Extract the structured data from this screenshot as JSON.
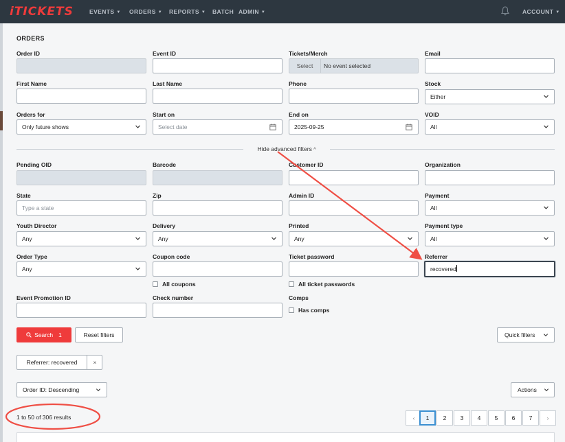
{
  "brand": {
    "logo_text": "iTICKETS",
    "accent": "#ef3b3b",
    "nav_bg": "#2d3740"
  },
  "nav": {
    "items": [
      {
        "label": "EVENTS",
        "has_caret": true
      },
      {
        "label": "ORDERS",
        "has_caret": true
      },
      {
        "label": "REPORTS",
        "has_caret": true
      },
      {
        "label": "BATCH",
        "has_caret": false
      },
      {
        "label": "ADMIN",
        "has_caret": true
      }
    ],
    "account_label": "ACCOUNT",
    "bell_icon": "bell-icon"
  },
  "page": {
    "title": "ORDERS"
  },
  "filters": {
    "order_id": {
      "label": "Order ID",
      "value": ""
    },
    "event_id": {
      "label": "Event ID",
      "value": ""
    },
    "tickets_merch": {
      "label": "Tickets/Merch",
      "button": "Select",
      "value": "No event selected"
    },
    "email": {
      "label": "Email",
      "value": ""
    },
    "first_name": {
      "label": "First Name",
      "value": ""
    },
    "last_name": {
      "label": "Last Name",
      "value": ""
    },
    "phone": {
      "label": "Phone",
      "value": ""
    },
    "stock": {
      "label": "Stock",
      "value": "Either"
    },
    "orders_for": {
      "label": "Orders for",
      "value": "Only future shows"
    },
    "start_on": {
      "label": "Start on",
      "placeholder": "Select date",
      "value": ""
    },
    "end_on": {
      "label": "End on",
      "value": "2025-09-25"
    },
    "void": {
      "label": "VOID",
      "value": "All"
    }
  },
  "advanced_toggle": {
    "label": "Hide advanced filters"
  },
  "advanced": {
    "pending_oid": {
      "label": "Pending OID",
      "value": ""
    },
    "barcode": {
      "label": "Barcode",
      "value": ""
    },
    "customer_id": {
      "label": "Customer ID",
      "value": ""
    },
    "organization": {
      "label": "Organization",
      "value": ""
    },
    "state": {
      "label": "State",
      "placeholder": "Type a state",
      "value": ""
    },
    "zip": {
      "label": "Zip",
      "value": ""
    },
    "admin_id": {
      "label": "Admin ID",
      "value": ""
    },
    "payment": {
      "label": "Payment",
      "value": "All"
    },
    "youth_director": {
      "label": "Youth Director",
      "value": "Any"
    },
    "delivery": {
      "label": "Delivery",
      "value": "Any"
    },
    "printed": {
      "label": "Printed",
      "value": "Any"
    },
    "payment_type": {
      "label": "Payment type",
      "value": "All"
    },
    "order_type": {
      "label": "Order Type",
      "value": "Any"
    },
    "coupon_code": {
      "label": "Coupon code",
      "value": "",
      "checkbox": "All coupons"
    },
    "ticket_password": {
      "label": "Ticket password",
      "value": "",
      "checkbox": "All ticket passwords"
    },
    "referrer": {
      "label": "Referrer",
      "value": "recovered"
    },
    "event_promotion_id": {
      "label": "Event Promotion ID",
      "value": ""
    },
    "check_number": {
      "label": "Check number",
      "value": ""
    },
    "comps": {
      "label": "Comps",
      "checkbox": "Has comps"
    }
  },
  "actions": {
    "search_label": "Search",
    "search_count": "1",
    "reset_label": "Reset filters",
    "quick_filters_label": "Quick filters",
    "active_chip": "Referrer: recovered",
    "chip_remove": "×",
    "sort_label": "Order ID: Descending",
    "actions_label": "Actions"
  },
  "results": {
    "summary": "1 to 50 of 306 results",
    "pages": [
      "1",
      "2",
      "3",
      "4",
      "5",
      "6",
      "7"
    ],
    "current_page": 1,
    "prev": "‹",
    "next": "›"
  },
  "annotations": {
    "arrow_color": "#ef4f45",
    "circle_color": "#ef4f45"
  }
}
